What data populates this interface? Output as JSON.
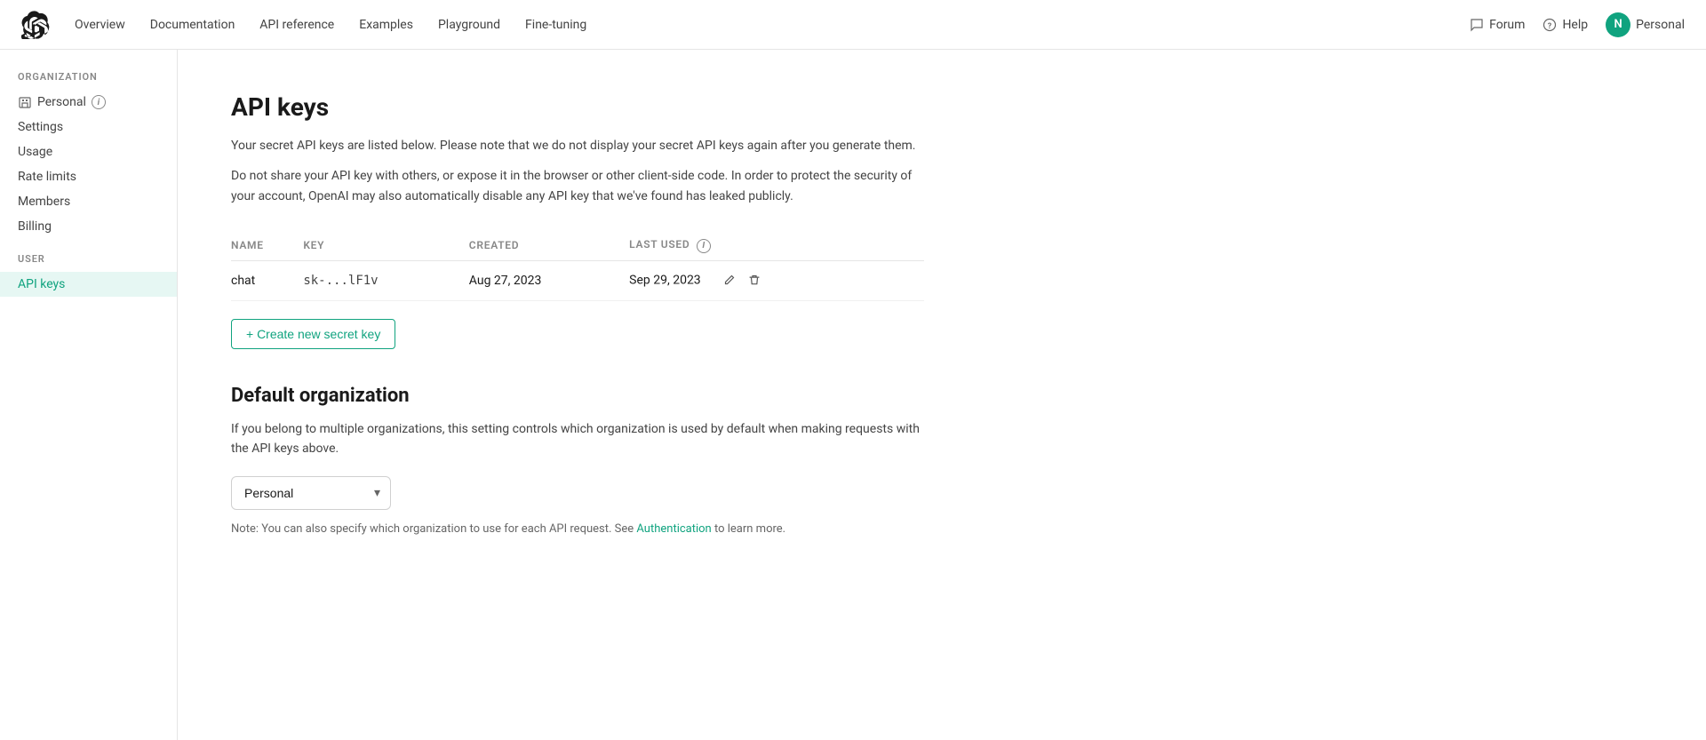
{
  "topnav": {
    "links": [
      {
        "label": "Overview",
        "href": "#"
      },
      {
        "label": "Documentation",
        "href": "#"
      },
      {
        "label": "API reference",
        "href": "#"
      },
      {
        "label": "Examples",
        "href": "#"
      },
      {
        "label": "Playground",
        "href": "#"
      },
      {
        "label": "Fine-tuning",
        "href": "#"
      }
    ],
    "right": [
      {
        "label": "Forum",
        "icon": "forum-icon"
      },
      {
        "label": "Help",
        "icon": "help-icon"
      }
    ],
    "user": {
      "initial": "N",
      "name": "Personal"
    }
  },
  "sidebar": {
    "org_section_label": "ORGANIZATION",
    "org_name": "Personal",
    "items_org": [
      {
        "label": "Settings",
        "active": false
      },
      {
        "label": "Usage",
        "active": false
      },
      {
        "label": "Rate limits",
        "active": false
      },
      {
        "label": "Members",
        "active": false
      },
      {
        "label": "Billing",
        "active": false
      }
    ],
    "user_section_label": "USER",
    "items_user": [
      {
        "label": "API keys",
        "active": true
      }
    ]
  },
  "main": {
    "title": "API keys",
    "description1": "Your secret API keys are listed below. Please note that we do not display your secret API keys again after you generate them.",
    "description2": "Do not share your API key with others, or expose it in the browser or other client-side code. In order to protect the security of your account, OpenAI may also automatically disable any API key that we've found has leaked publicly.",
    "table": {
      "columns": [
        {
          "key": "name",
          "label": "NAME"
        },
        {
          "key": "key",
          "label": "KEY"
        },
        {
          "key": "created",
          "label": "CREATED"
        },
        {
          "key": "last_used",
          "label": "LAST USED"
        }
      ],
      "rows": [
        {
          "name": "chat",
          "key": "sk-...lF1v",
          "created": "Aug 27, 2023",
          "last_used": "Sep 29, 2023"
        }
      ]
    },
    "create_button_label": "+ Create new secret key",
    "default_org_title": "Default organization",
    "default_org_desc": "If you belong to multiple organizations, this setting controls which organization is used by default when making requests with the API keys above.",
    "org_select_value": "Personal",
    "org_options": [
      "Personal"
    ],
    "note_text": "Note: You can also specify which organization to use for each API request. See ",
    "note_link_label": "Authentication",
    "note_text2": " to learn more."
  }
}
